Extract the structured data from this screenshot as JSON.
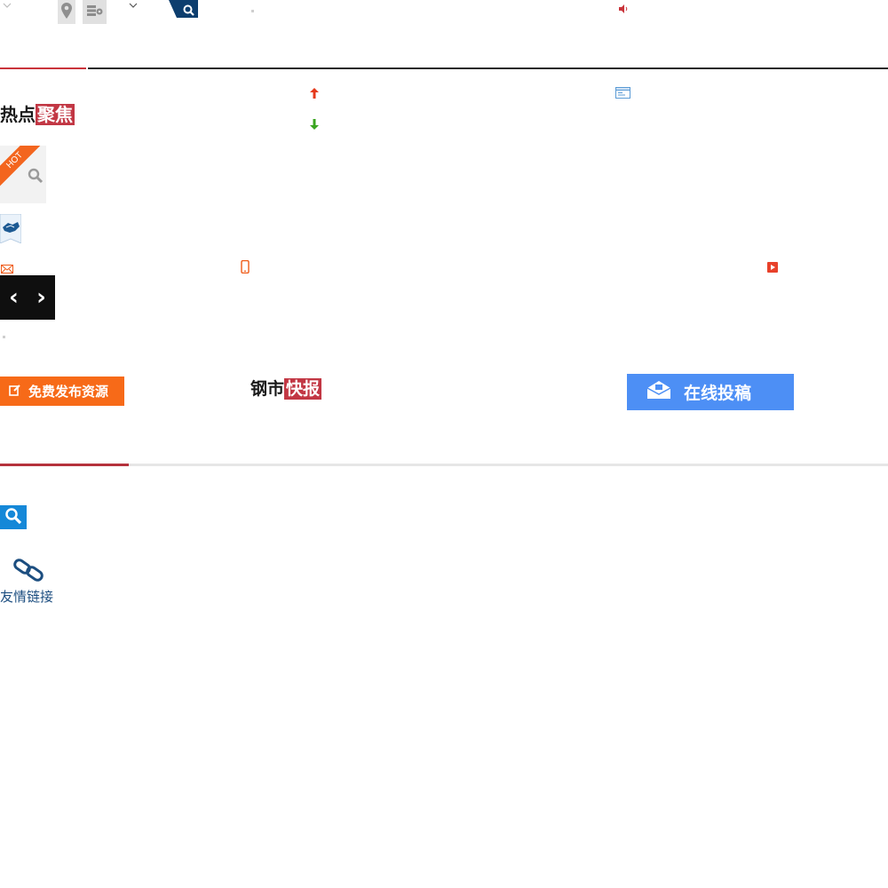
{
  "headings": {
    "hot_focus_black": "热点",
    "hot_focus_badge": "聚焦",
    "steel_news_black": "钢市",
    "steel_news_badge": "快报"
  },
  "hot_badge": "HOT",
  "buttons": {
    "free_publish": "免费发布资源",
    "online_submit": "在线投稿"
  },
  "carousel": {
    "prev": "‹",
    "next": "›"
  },
  "footer": {
    "friendly_links": "友情链接"
  },
  "colors": {
    "brand_red": "#c23744",
    "nav_blue": "#0d3e6e",
    "orange": "#f76a18",
    "submit_blue": "#4d8ff5",
    "search_blue": "#1588d8"
  },
  "icons": [
    "chevron-down-icon",
    "map-pin-icon",
    "stack-icon",
    "search-icon",
    "speaker-icon",
    "arrow-up-icon",
    "arrow-down-icon",
    "window-icon",
    "handshake-icon",
    "mail-icon",
    "mobile-icon",
    "play-icon",
    "edit-icon",
    "envelope-icon",
    "link-icon"
  ]
}
